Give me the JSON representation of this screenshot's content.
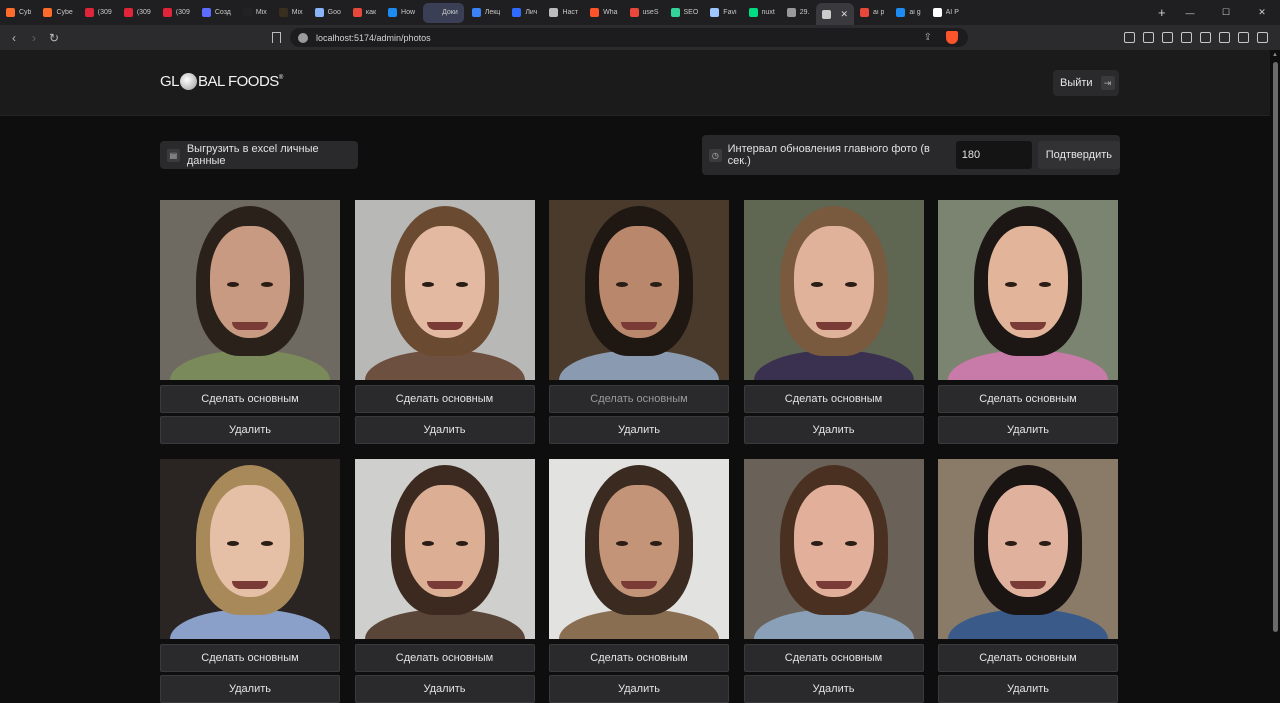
{
  "browser": {
    "tabs": [
      {
        "label": "Cyb",
        "color": "#ff6b2b"
      },
      {
        "label": "Cybe",
        "color": "#ff6b2b"
      },
      {
        "label": "(309",
        "color": "#e0243a"
      },
      {
        "label": "(309",
        "color": "#e0243a"
      },
      {
        "label": "(309",
        "color": "#e0243a"
      },
      {
        "label": "Созд",
        "color": "#5b6cff"
      },
      {
        "label": "Mix",
        "color": "#222222"
      },
      {
        "label": "Mix",
        "color": "#3a2f1e"
      },
      {
        "label": "Goo",
        "color": "#8ab4f8"
      },
      {
        "label": "как",
        "color": "#e8473b"
      },
      {
        "label": "How",
        "color": "#1c8bf2"
      },
      {
        "label": "Доки",
        "color": "#3a3f55"
      },
      {
        "label": "Лекц",
        "color": "#3b82f6"
      },
      {
        "label": "Лич",
        "color": "#2f6bff"
      },
      {
        "label": "Наст",
        "color": "#bbbbbb"
      },
      {
        "label": "Wha",
        "color": "#fb542b"
      },
      {
        "label": "useS",
        "color": "#e8473b"
      },
      {
        "label": "SEO",
        "color": "#34d399"
      },
      {
        "label": "Favi",
        "color": "#9ec5fe"
      },
      {
        "label": "nuxt",
        "color": "#00dc82"
      },
      {
        "label": "29.",
        "color": "#999999"
      },
      {
        "label": "",
        "color": "#cccccc"
      },
      {
        "label": "ai p",
        "color": "#e8473b"
      },
      {
        "label": "ai g",
        "color": "#1c8bf2"
      },
      {
        "label": "AI P",
        "color": "#ffffff"
      }
    ],
    "url": "localhost:5174/admin/photos"
  },
  "header": {
    "logo_text_left": "GL",
    "logo_text_right": "BAL FOODS",
    "logo_reg": "®",
    "logout_label": "Выйти"
  },
  "toolbar": {
    "export_label": "Выгрузить в excel личные данные",
    "interval_label": "Интервал обновления главного фото (в сек.)",
    "interval_value": "180",
    "confirm_label": "Подтвердить"
  },
  "photos": [
    {
      "make_main_label": "Сделать основным",
      "delete_label": "Удалить",
      "is_main": false,
      "bg": "#6e6a62",
      "hair": "#2a211b",
      "skin": "#c89a82",
      "body": "#7a8a5a"
    },
    {
      "make_main_label": "Сделать основным",
      "delete_label": "Удалить",
      "is_main": false,
      "bg": "#b8b8b6",
      "hair": "#6b4a32",
      "skin": "#e3b9a2",
      "body": "#6e5040"
    },
    {
      "make_main_label": "Сделать основным",
      "delete_label": "Удалить",
      "is_main": true,
      "bg": "#4a3a2c",
      "hair": "#1e1712",
      "skin": "#b9886c",
      "body": "#8a9ab0"
    },
    {
      "make_main_label": "Сделать основным",
      "delete_label": "Удалить",
      "is_main": false,
      "bg": "#5f6652",
      "hair": "#7a5a3e",
      "skin": "#e0b29a",
      "body": "#3a3050"
    },
    {
      "make_main_label": "Сделать основным",
      "delete_label": "Удалить",
      "is_main": false,
      "bg": "#7b8470",
      "hair": "#1c1714",
      "skin": "#e2b49a",
      "body": "#c87aa8"
    },
    {
      "make_main_label": "Сделать основным",
      "delete_label": "Удалить",
      "is_main": false,
      "bg": "#2a2522",
      "hair": "#a88a5a",
      "skin": "#e6c0a6",
      "body": "#8aa0c8"
    },
    {
      "make_main_label": "Сделать основным",
      "delete_label": "Удалить",
      "is_main": false,
      "bg": "#cfcfcd",
      "hair": "#3c2a20",
      "skin": "#dcae94",
      "body": "#5a4638"
    },
    {
      "make_main_label": "Сделать основным",
      "delete_label": "Удалить",
      "is_main": false,
      "bg": "#e2e2e0",
      "hair": "#3a2a20",
      "skin": "#c49478",
      "body": "#8a6e52"
    },
    {
      "make_main_label": "Сделать основным",
      "delete_label": "Удалить",
      "is_main": false,
      "bg": "#6a6258",
      "hair": "#4a3020",
      "skin": "#e2b09a",
      "body": "#8aa0b8"
    },
    {
      "make_main_label": "Сделать основным",
      "delete_label": "Удалить",
      "is_main": false,
      "bg": "#8a7a68",
      "hair": "#1a1412",
      "skin": "#e0b29e",
      "body": "#3a5a8a"
    }
  ]
}
